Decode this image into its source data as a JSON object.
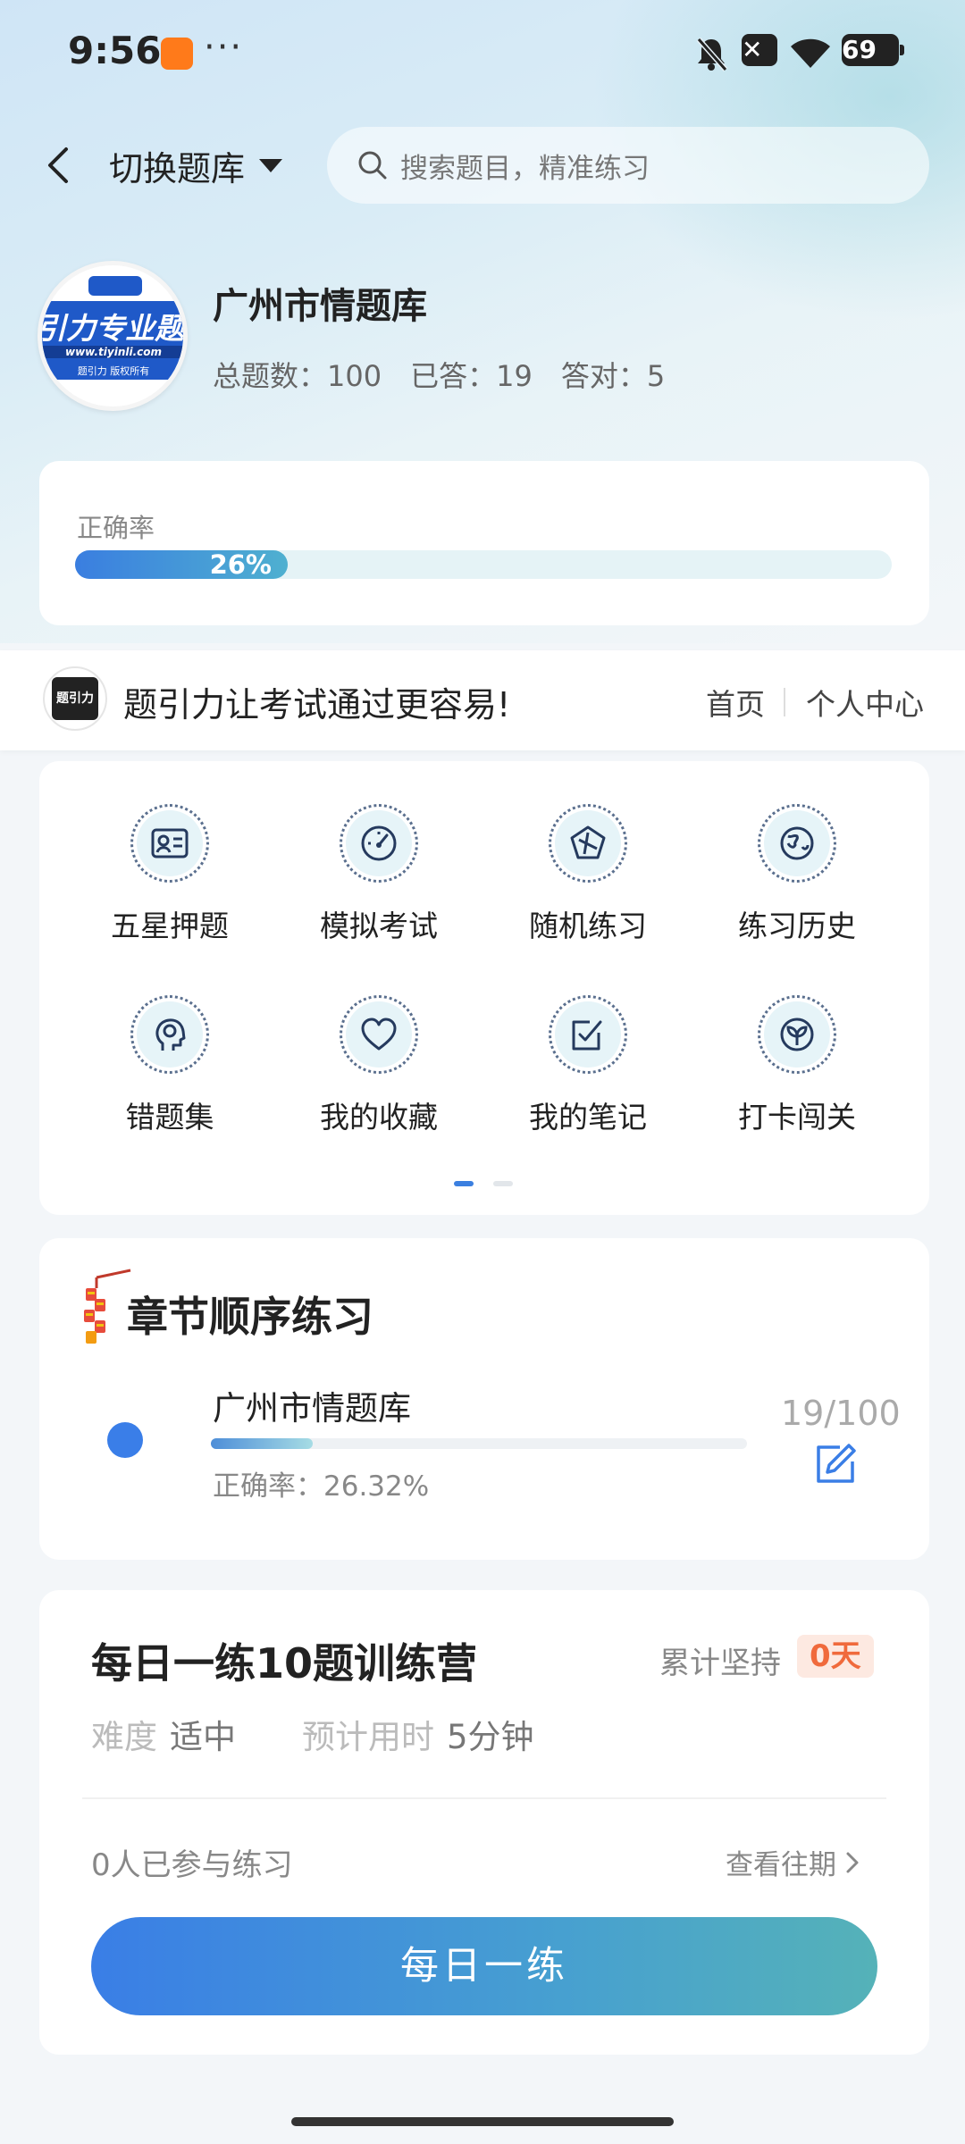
{
  "status": {
    "time": "9:56",
    "dots": "···",
    "x_icon": "✕",
    "battery": "69"
  },
  "header": {
    "switch_label": "切换题库",
    "search_placeholder": "搜索题目，精准练习"
  },
  "bank": {
    "logo_text": "引力专业题",
    "logo_url": "www.tiyinli.com",
    "logo_small": "题引力 版权所有",
    "title": "广州市情题库",
    "total": "总题数：100",
    "answered": "已答：19",
    "correct": "答对：5"
  },
  "accuracy": {
    "label": "正确率",
    "percent_text": "26%",
    "percent_value": 26
  },
  "brand_bar": {
    "icon_text": "题引力",
    "slogan": "题引力让考试通过更容易!",
    "home": "首页",
    "profile": "个人中心"
  },
  "features": [
    {
      "label": "五星押题",
      "icon": "id-card-icon"
    },
    {
      "label": "模拟考试",
      "icon": "gauge-icon"
    },
    {
      "label": "随机练习",
      "icon": "shuffle-icon"
    },
    {
      "label": "练习历史",
      "icon": "globe-icon"
    },
    {
      "label": "错题集",
      "icon": "brain-head-icon"
    },
    {
      "label": "我的收藏",
      "icon": "heart-icon"
    },
    {
      "label": "我的笔记",
      "icon": "note-check-icon"
    },
    {
      "label": "打卡闯关",
      "icon": "sprout-icon"
    }
  ],
  "pager": {
    "active_page": 1,
    "pages": 2
  },
  "chapter": {
    "title": "章节顺序练习",
    "name": "广州市情题库",
    "progress_value": 0.19,
    "accuracy": "正确率：26.32%",
    "count": "19/100"
  },
  "daily": {
    "title": "每日一练10题训练营",
    "persist_label": "累计坚持",
    "persist_value": "0天",
    "difficulty_label": "难度",
    "difficulty_value": "适中",
    "time_label": "预计用时",
    "time_value": "5分钟",
    "joined": "0人已参与练习",
    "history": "查看往期",
    "button": "每日一练"
  },
  "colors": {
    "accent": "#3a7ee6",
    "teal": "#55b2b8",
    "badge_text": "#f06a3c"
  }
}
